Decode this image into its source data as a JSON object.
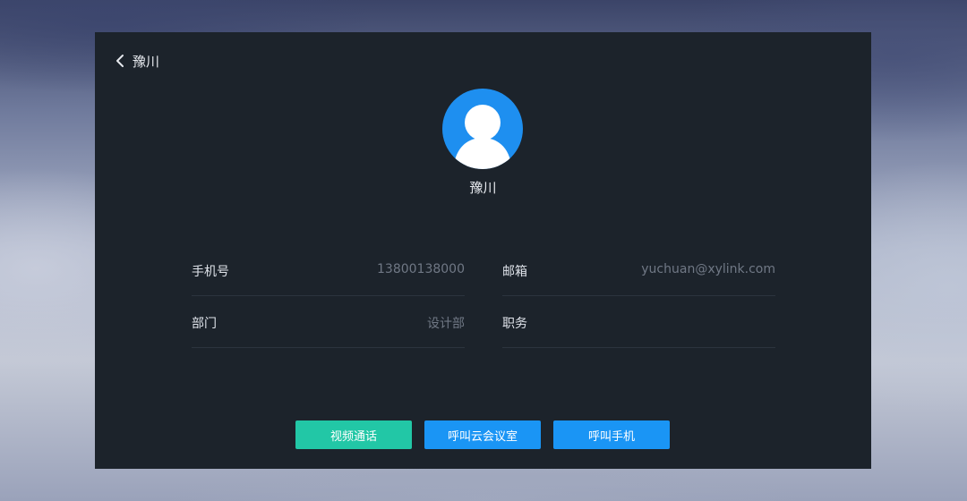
{
  "header": {
    "back_label": "豫川"
  },
  "profile": {
    "name": "豫川",
    "avatar_icon": "user-avatar-icon"
  },
  "fields": {
    "phone": {
      "label": "手机号",
      "value": "13800138000"
    },
    "email": {
      "label": "邮箱",
      "value": "yuchuan@xylink.com"
    },
    "department": {
      "label": "部门",
      "value": "设计部"
    },
    "position": {
      "label": "职务",
      "value": ""
    }
  },
  "actions": {
    "video_call": "视频通话",
    "call_cloud_room": "呼叫云会议室",
    "call_mobile": "呼叫手机"
  },
  "colors": {
    "panel_bg": "#1c232b",
    "avatar_blue": "#1e8ff0",
    "button_green": "#22c7a6",
    "button_blue": "#1a95f5"
  }
}
